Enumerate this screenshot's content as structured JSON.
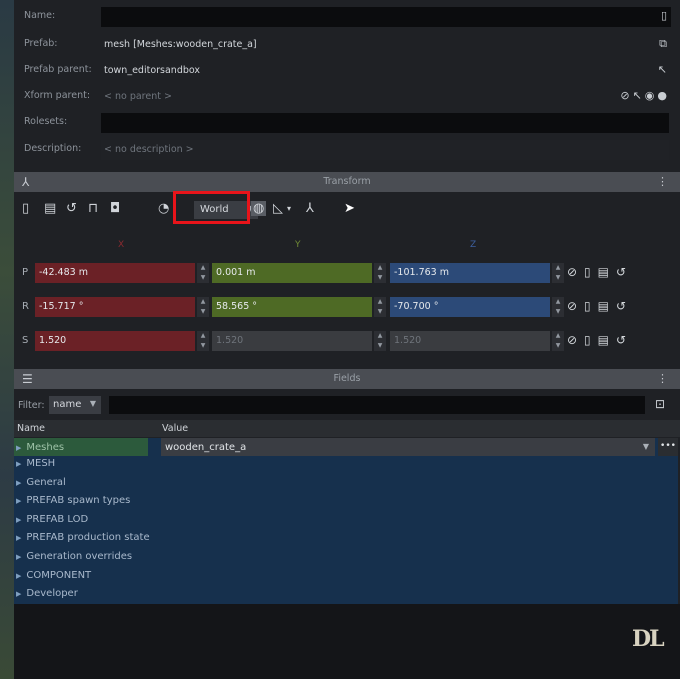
{
  "properties": {
    "name": {
      "label": "Name:",
      "value": ""
    },
    "prefab": {
      "label": "Prefab:",
      "value": "mesh [Meshes:wooden_crate_a]"
    },
    "prefab_parent": {
      "label": "Prefab parent:",
      "value": "town_editorsandbox"
    },
    "xform_parent": {
      "label": "Xform parent:",
      "placeholder": "< no parent >"
    },
    "rolesets": {
      "label": "Rolesets:",
      "value": ""
    },
    "description": {
      "label": "Description:",
      "placeholder": "< no description >"
    }
  },
  "transform": {
    "title": "Transform",
    "space_dropdown": "World",
    "axes": {
      "x": "X",
      "y": "Y",
      "z": "Z"
    },
    "position": {
      "label": "P",
      "x": "-42.483 m",
      "y": "0.001 m",
      "z": "-101.763 m"
    },
    "rotation": {
      "label": "R",
      "x": "-15.717 °",
      "y": "58.565 °",
      "z": "-70.700 °"
    },
    "scale": {
      "label": "S",
      "x": "1.520",
      "y": "1.520",
      "z": "1.520"
    }
  },
  "fields": {
    "title": "Fields",
    "filter_label": "Filter:",
    "filter_mode": "name",
    "filter_value": "",
    "columns": {
      "name": "Name",
      "value": "Value"
    },
    "meshes": {
      "name": "Meshes",
      "value": "wooden_crate_a",
      "more": "•••"
    },
    "groups": [
      "MESH",
      "General",
      "PREFAB spawn types",
      "PREFAB LOD",
      "PREFAB production state",
      "Generation overrides",
      "COMPONENT",
      "Developer"
    ]
  },
  "watermark": "DL",
  "colors": {
    "x_axis": "#6b2126",
    "y_axis": "#4e6a25",
    "z_axis": "#2c4a78",
    "highlight": "#e8141a",
    "list_bg": "#16304d"
  }
}
